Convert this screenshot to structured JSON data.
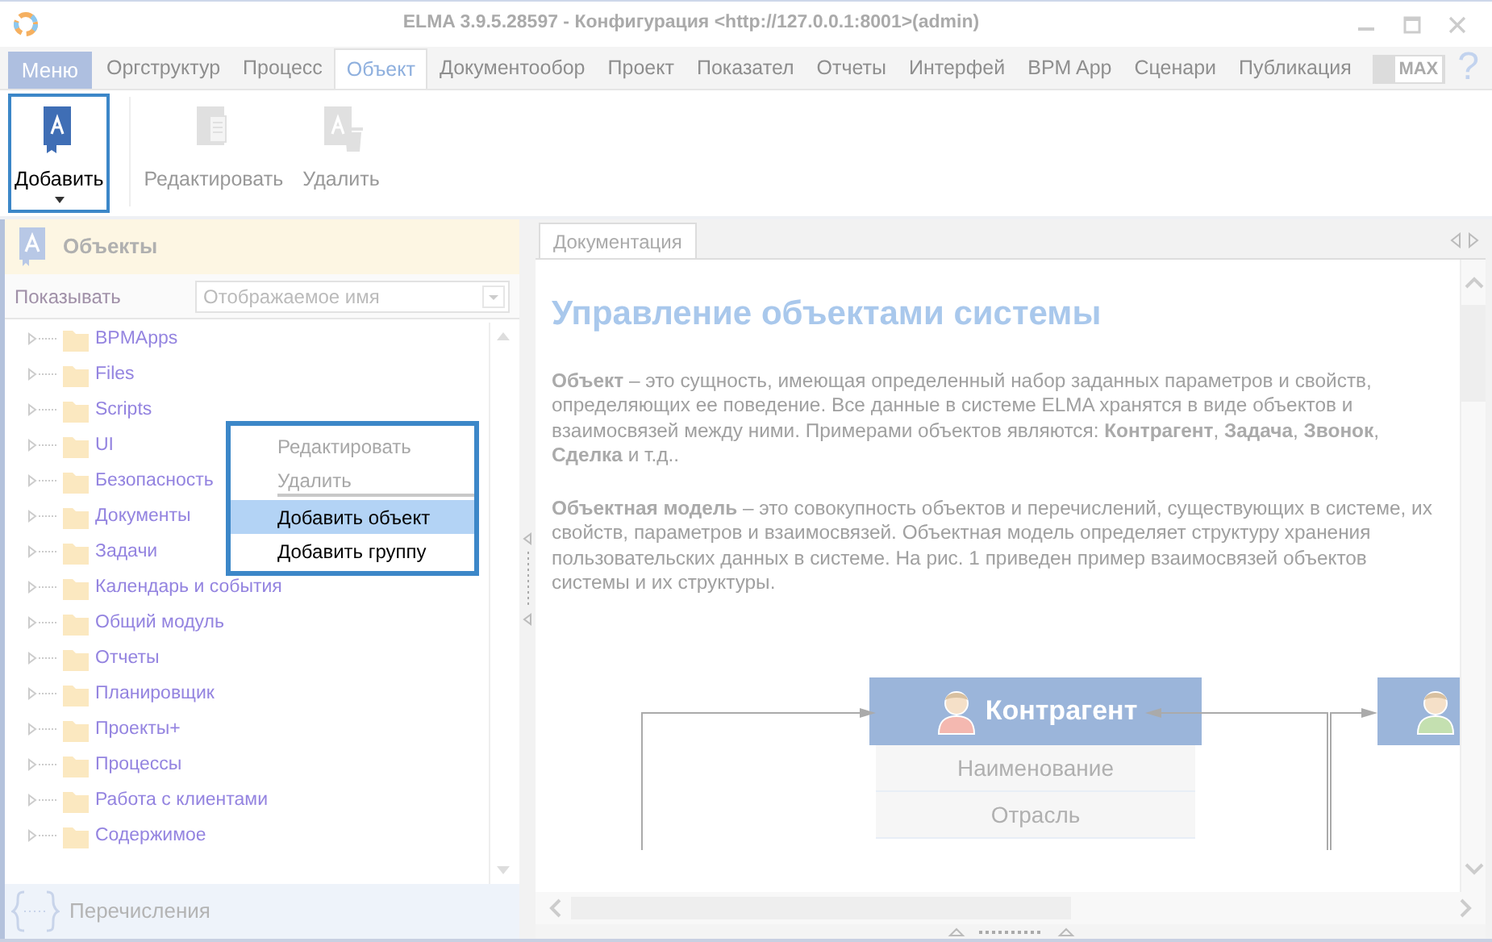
{
  "window": {
    "title": "ELMA 3.9.5.28597 - Конфигурация <http://127.0.0.1:8001>(admin)"
  },
  "menu_button": "Меню",
  "tabs": [
    {
      "label": "Оргструктур",
      "selected": false
    },
    {
      "label": "Процесс",
      "selected": false
    },
    {
      "label": "Объект",
      "selected": true
    },
    {
      "label": "Документообор",
      "selected": false
    },
    {
      "label": "Проект",
      "selected": false
    },
    {
      "label": "Показател",
      "selected": false
    },
    {
      "label": "Отчеты",
      "selected": false
    },
    {
      "label": "Интерфей",
      "selected": false
    },
    {
      "label": "BPM App",
      "selected": false
    },
    {
      "label": "Сценари",
      "selected": false
    },
    {
      "label": "Публикация",
      "selected": false
    }
  ],
  "max_toggle": {
    "label": "MAX",
    "on": false
  },
  "help": "?",
  "ribbon": [
    {
      "kind": "add",
      "label": "Добавить",
      "disabled": false,
      "selected": true
    },
    {
      "kind": "edit",
      "label": "Редактировать",
      "disabled": true,
      "selected": false
    },
    {
      "kind": "delete",
      "label": "Удалить",
      "disabled": true,
      "selected": false
    }
  ],
  "left_panel": {
    "title": "Объекты",
    "show_label": "Показывать",
    "show_select": "Отображаемое имя",
    "tree": [
      {
        "label": "BPMApps",
        "expanded": false
      },
      {
        "label": "Files",
        "expanded": false
      },
      {
        "label": "Scripts",
        "expanded": false
      },
      {
        "label": "UI",
        "expanded": false
      },
      {
        "label": "Безопасность",
        "expanded": false
      },
      {
        "label": "Документы",
        "expanded": false
      },
      {
        "label": "Задачи",
        "expanded": false
      },
      {
        "label": "Календарь и события",
        "expanded": false
      },
      {
        "label": "Общий модуль",
        "expanded": false
      },
      {
        "label": "Отчеты",
        "expanded": false
      },
      {
        "label": "Планировщик",
        "expanded": false
      },
      {
        "label": "Проекты+",
        "expanded": false
      },
      {
        "label": "Процессы",
        "expanded": false
      },
      {
        "label": "Работа с клиентами",
        "expanded": false
      },
      {
        "label": "Содержимое",
        "expanded": false
      }
    ],
    "footer": "Перечисления"
  },
  "context_menu": [
    {
      "label": "Редактировать",
      "disabled": true,
      "selected": false,
      "divider_after": false
    },
    {
      "label": "Удалить",
      "disabled": true,
      "selected": false,
      "divider_after": true
    },
    {
      "label": "Добавить объект",
      "disabled": false,
      "selected": true,
      "divider_after": false
    },
    {
      "label": "Добавить группу",
      "disabled": false,
      "selected": false,
      "divider_after": false
    }
  ],
  "doc_tabs": [
    {
      "label": "Документация",
      "selected": true
    }
  ],
  "doc": {
    "heading": "Управление объектами системы",
    "paragraphs": [
      "**Объект** – это сущность, имеющая определенный набор заданных параметров и свойств, определяющих ее поведение. Все данные в системе ELMA хранятся в виде объектов и взаимосвязей между ними. Примерами объектов являются: **Контрагент**, **Задача**, **Звонок**, **Сделка** и т.д..",
      "**Объектная модель** – это совокупность объектов и перечислений, существующих в системе, их свойств, параметров и взаимосвязей. Объектная модель определяет структуру хранения пользовательских данных в системе. На рис. 1 приведен пример взаимосвязей объектов системы и их структуры."
    ],
    "diagram": {
      "entities": [
        {
          "title": "Контрагент",
          "color": "#f4b8b0",
          "fields": [
            "Наименование",
            "Отрасль"
          ]
        },
        {
          "color": "#c4e0b0"
        }
      ]
    }
  }
}
